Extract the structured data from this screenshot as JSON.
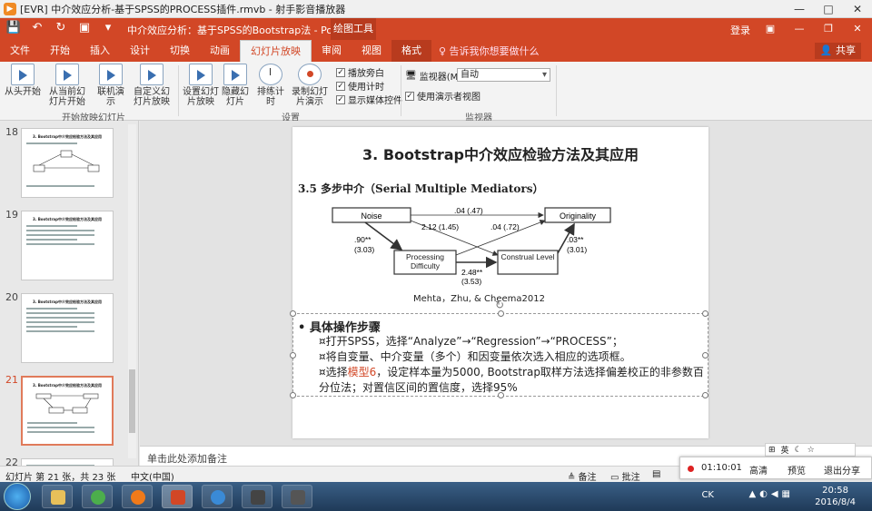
{
  "player": {
    "title": "[EVR] 中介效应分析-基于SPSS的PROCESS插件.rmvb - 射手影音播放器",
    "controls": [
      "—",
      "□",
      "✕"
    ]
  },
  "ppt": {
    "doc_title": "中介效应分析：基于SPSS的Bootstrap法  -  PowerPoint",
    "context_tool": "绘图工具",
    "login": "登录",
    "window_controls": [
      "▣",
      "—",
      "❐",
      "✕"
    ],
    "tabs": [
      "文件",
      "开始",
      "插入",
      "设计",
      "切换",
      "动画",
      "幻灯片放映",
      "审阅",
      "视图",
      "格式"
    ],
    "active_tab": "幻灯片放映",
    "tell_me": "♀ 告诉我你想要做什么",
    "share": "共享"
  },
  "ribbon": {
    "buttons": [
      "从头开始",
      "从当前幻灯片开始",
      "联机演示",
      "自定义幻灯片放映",
      "设置幻灯片放映",
      "隐藏幻灯片",
      "排练计时",
      "录制幻灯片演示"
    ],
    "checkboxes": [
      "播放旁白",
      "使用计时",
      "显示媒体控件"
    ],
    "monitor_label": "监视器(M):",
    "monitor_value": "自动",
    "presenter_view": "使用演示者视图",
    "group_labels": [
      "开始放映幻灯片",
      "设置",
      "监视器"
    ]
  },
  "thumbnails": {
    "numbers": [
      "18",
      "19",
      "20",
      "21",
      "22"
    ],
    "titles": [
      "3. Bootstrap中介效应检验方法及其应用",
      "3. Bootstrap中介效应检验方法及其应用",
      "3. Bootstrap中介效应检验方法及其应用",
      "3. Bootstrap中介效应检验方法及其应用"
    ]
  },
  "slide": {
    "title": "3. Bootstrap中介效应检验方法及其应用",
    "subtitle": "3.5 多步中介（Serial Multiple Mediators）",
    "diagram": {
      "nodes": [
        "Noise",
        "Originality",
        "Processing Difficulty",
        "Construal Level"
      ],
      "coef_top": ".04 (.47)",
      "coef_cross1": "2.12 (1.45)",
      "coef_cross2": ".04 (.72)",
      "coef_left": ".90**",
      "coef_left_se": "(3.03)",
      "coef_mid": "2.48**",
      "coef_mid_se": "(3.53)",
      "coef_right": ".03**",
      "coef_right_se": "(3.01)"
    },
    "citation": "Mehta，Zhu, & Cheema2012",
    "heading": "具体操作步骤",
    "steps": [
      "¤打开SPSS，选择“Analyze”→“Regression”→“PROCESS”；",
      "¤将自变量、中介变量（多个）和因变量依次选入相应的选项框。"
    ],
    "step3_prefix": "¤选择",
    "step3_highlight": "模型6",
    "step3_suffix": "，设定样本量为5000, Bootstrap取样方法选择偏差校正的非参数百分位法；对置信区间的置信度，选择95%"
  },
  "notes": {
    "placeholder": "单击此处添加备注"
  },
  "status": {
    "slide_count": "幻灯片 第 21 张，共 23 张",
    "language": "中文(中国)",
    "notes_btn": "≜ 备注",
    "comments_btn": "▭ 批注"
  },
  "recorder": {
    "time": "01:10:01",
    "options": [
      "高清",
      "预览",
      "退出分享"
    ]
  },
  "ime": {
    "items": [
      "⊞",
      "英",
      "☾",
      "☆"
    ]
  },
  "taskbar": {
    "ck": "CK",
    "time": "20:58",
    "date": "2016/8/4"
  }
}
